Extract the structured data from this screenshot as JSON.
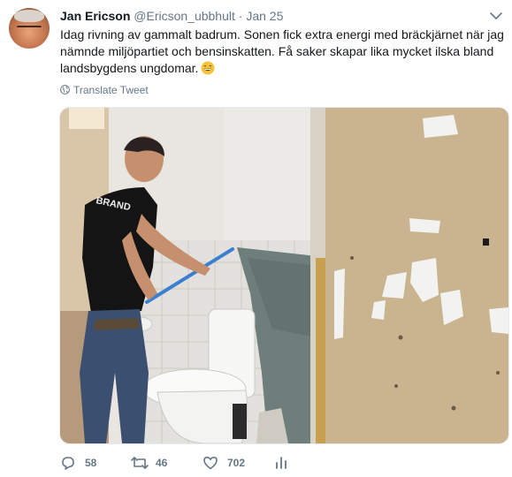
{
  "tweet": {
    "author_name": "Jan Ericson",
    "handle": "@Ericson_ubbhult",
    "separator": "·",
    "date": "Jan 25",
    "text": "Idag rivning av gammalt badrum. Sonen fick extra energi med bräckjärnet när jag nämnde miljöpartiet och bensinskatten. Få saker skapar lika mycket ilska bland landsbygdens ungdomar.",
    "emoji": "grinning-face-emoji",
    "translate_label": "Translate Tweet",
    "photo_shirt_text": "BRAND"
  },
  "actions": {
    "replies": "58",
    "retweets": "46",
    "likes": "702"
  },
  "colors": {
    "text": "#14171a",
    "secondary": "#657786",
    "border": "#e6ecf0"
  }
}
